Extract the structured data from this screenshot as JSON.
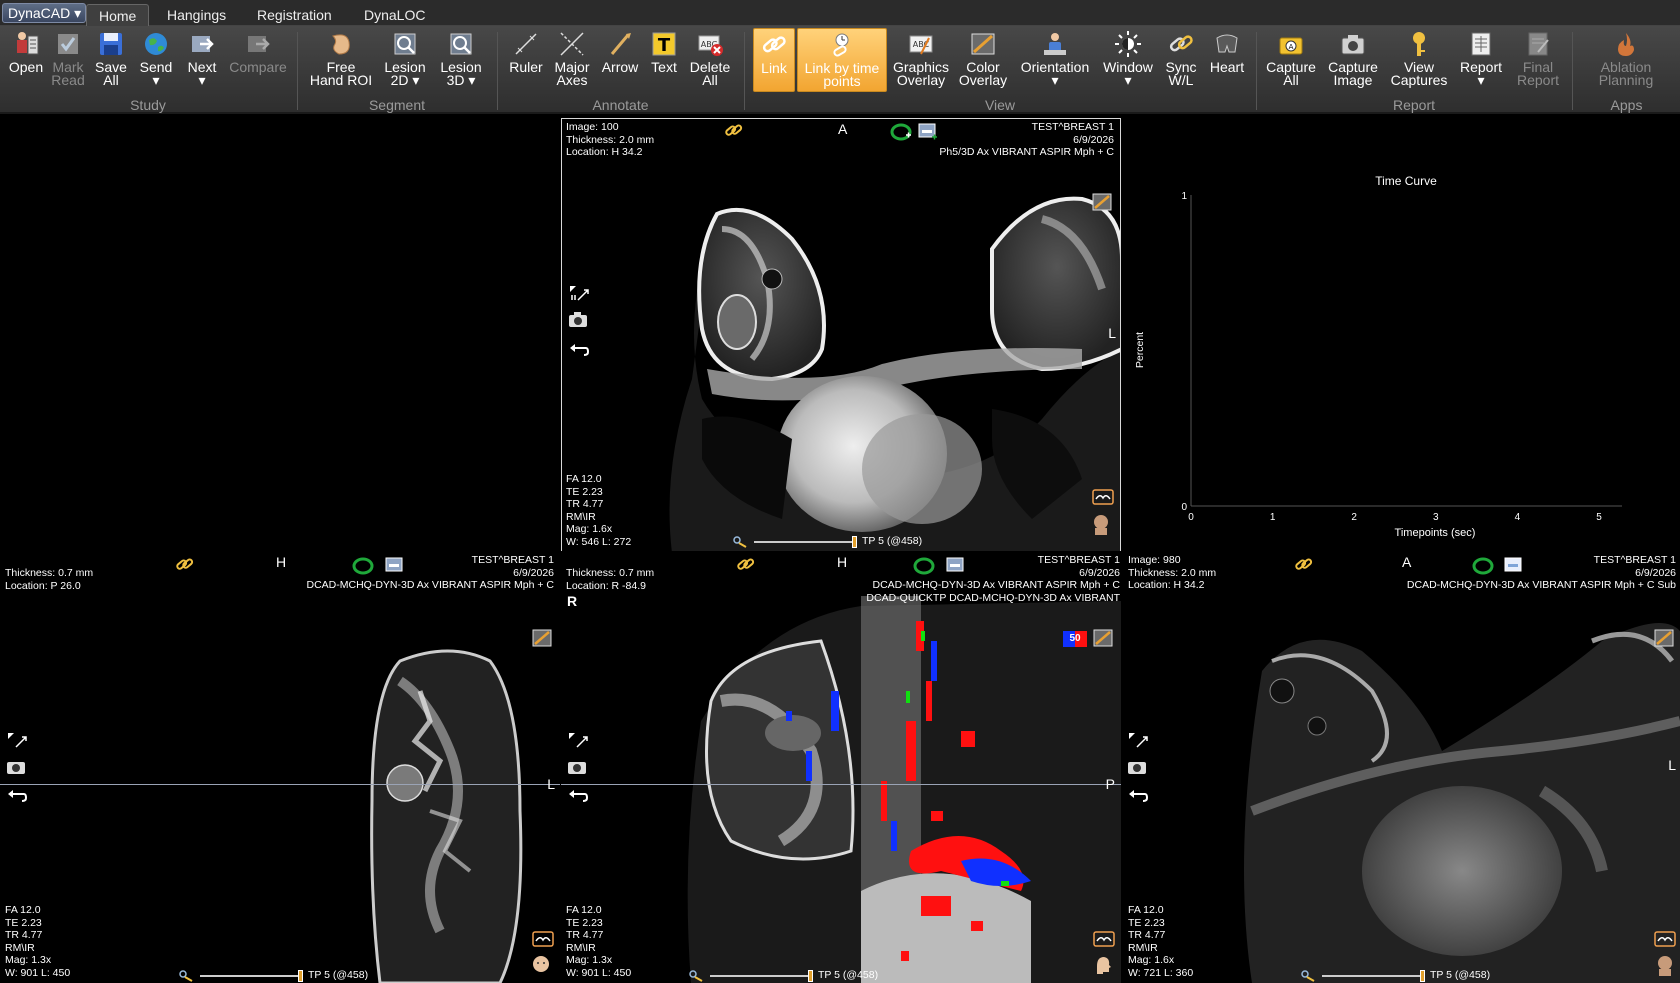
{
  "menubar": {
    "app_button": "DynaCAD ▾",
    "tabs": [
      "Home",
      "Hangings",
      "Registration",
      "DynaLOC"
    ]
  },
  "ribbon": {
    "groups": {
      "study": "Study",
      "segment": "Segment",
      "annotate": "Annotate",
      "view": "View",
      "report": "Report",
      "apps": "Apps"
    },
    "study": {
      "open": "Open",
      "mark_read": [
        "Mark",
        "Read"
      ],
      "save_all": [
        "Save",
        "All"
      ],
      "send": "Send",
      "next": "Next",
      "compare": "Compare"
    },
    "segment": {
      "free_hand_roi": [
        "Free",
        "Hand ROI"
      ],
      "lesion_2d": [
        "Lesion",
        "2D ▾"
      ],
      "lesion_3d": [
        "Lesion",
        "3D ▾"
      ]
    },
    "annotate": {
      "ruler": "Ruler",
      "major_axes": [
        "Major",
        "Axes"
      ],
      "arrow": "Arrow",
      "text": "Text",
      "delete_all": [
        "Delete",
        "All"
      ]
    },
    "view": {
      "link": "Link",
      "link_by_time_points": [
        "Link by time",
        "points"
      ],
      "graphics_overlay": [
        "Graphics",
        "Overlay"
      ],
      "color_overlay": [
        "Color",
        "Overlay"
      ],
      "orientation": "Orientation",
      "window": "Window",
      "sync_wl": [
        "Sync",
        "W/L"
      ],
      "heart": "Heart"
    },
    "report": {
      "capture_all": [
        "Capture",
        "All"
      ],
      "capture_image": [
        "Capture",
        "Image"
      ],
      "view_captures": [
        "View",
        "Captures"
      ],
      "report": "Report",
      "final_report": [
        "Final",
        "Report"
      ]
    },
    "apps": {
      "ablation_planning": [
        "Ablation",
        "Planning"
      ]
    }
  },
  "viewports": {
    "axial_top": {
      "tl": [
        "Image: 100",
        "Thickness: 2.0 mm",
        "Location: H 34.2"
      ],
      "tr": [
        "TEST^BREAST 1",
        "6/9/2026",
        "Ph5/3D Ax VIBRANT ASPIR Mph + C"
      ],
      "bl": [
        "FA 12.0",
        "TE 2.23",
        "TR 4.77",
        "RM\\IR",
        "Mag: 1.6x",
        "W: 546 L: 272"
      ],
      "orient_top": "A",
      "orient_right": "L",
      "tp": "TP 5 (@458)"
    },
    "sagittal": {
      "tl": [
        "Thickness: 0.7 mm",
        "Location: P 26.0"
      ],
      "tr": [
        "TEST^BREAST 1",
        "6/9/2026",
        "DCAD-MCHQ-DYN-3D Ax VIBRANT ASPIR Mph + C"
      ],
      "bl": [
        "FA 12.0",
        "TE 2.23",
        "TR 4.77",
        "RM\\IR",
        "Mag: 1.3x",
        "W: 901 L: 450"
      ],
      "orient_top": "H",
      "orient_right": "L",
      "tp": "TP 5 (@458)"
    },
    "coronal": {
      "tl": [
        "Thickness: 0.7 mm",
        "Location: R -84.9"
      ],
      "tr": [
        "TEST^BREAST 1",
        "6/9/2026",
        "DCAD-MCHQ-DYN-3D Ax VIBRANT ASPIR Mph + C",
        "DCAD-QUICKTP DCAD-MCHQ-DYN-3D Ax VIBRANT"
      ],
      "bl": [
        "FA 12.0",
        "TE 2.23",
        "TR 4.77",
        "RM\\IR",
        "Mag: 1.3x",
        "W: 901 L: 450"
      ],
      "orient_top": "H",
      "orient_left": "R",
      "orient_right": "P",
      "badge": "50",
      "tp": "TP 5 (@458)"
    },
    "subtraction": {
      "tl": [
        "Image: 980",
        "Thickness: 2.0 mm",
        "Location: H 34.2"
      ],
      "tr": [
        "TEST^BREAST 1",
        "6/9/2026",
        "DCAD-MCHQ-DYN-3D Ax VIBRANT ASPIR Mph + C Sub"
      ],
      "bl": [
        "FA 12.0",
        "TE 2.23",
        "TR 4.77",
        "RM\\IR",
        "Mag: 1.6x",
        "W: 721 L: 360"
      ],
      "orient_top": "A",
      "orient_right": "L",
      "tp": "TP 5 (@458)"
    }
  },
  "chart_data": {
    "type": "line",
    "title": "Time Curve",
    "xlabel": "Timepoints (sec)",
    "ylabel": "Percent",
    "xlim": [
      0,
      5
    ],
    "ylim": [
      0,
      1
    ],
    "x_ticks": [
      "0",
      "1",
      "2",
      "3",
      "4",
      "5"
    ],
    "y_ticks": [
      "0",
      "1"
    ],
    "series": []
  }
}
